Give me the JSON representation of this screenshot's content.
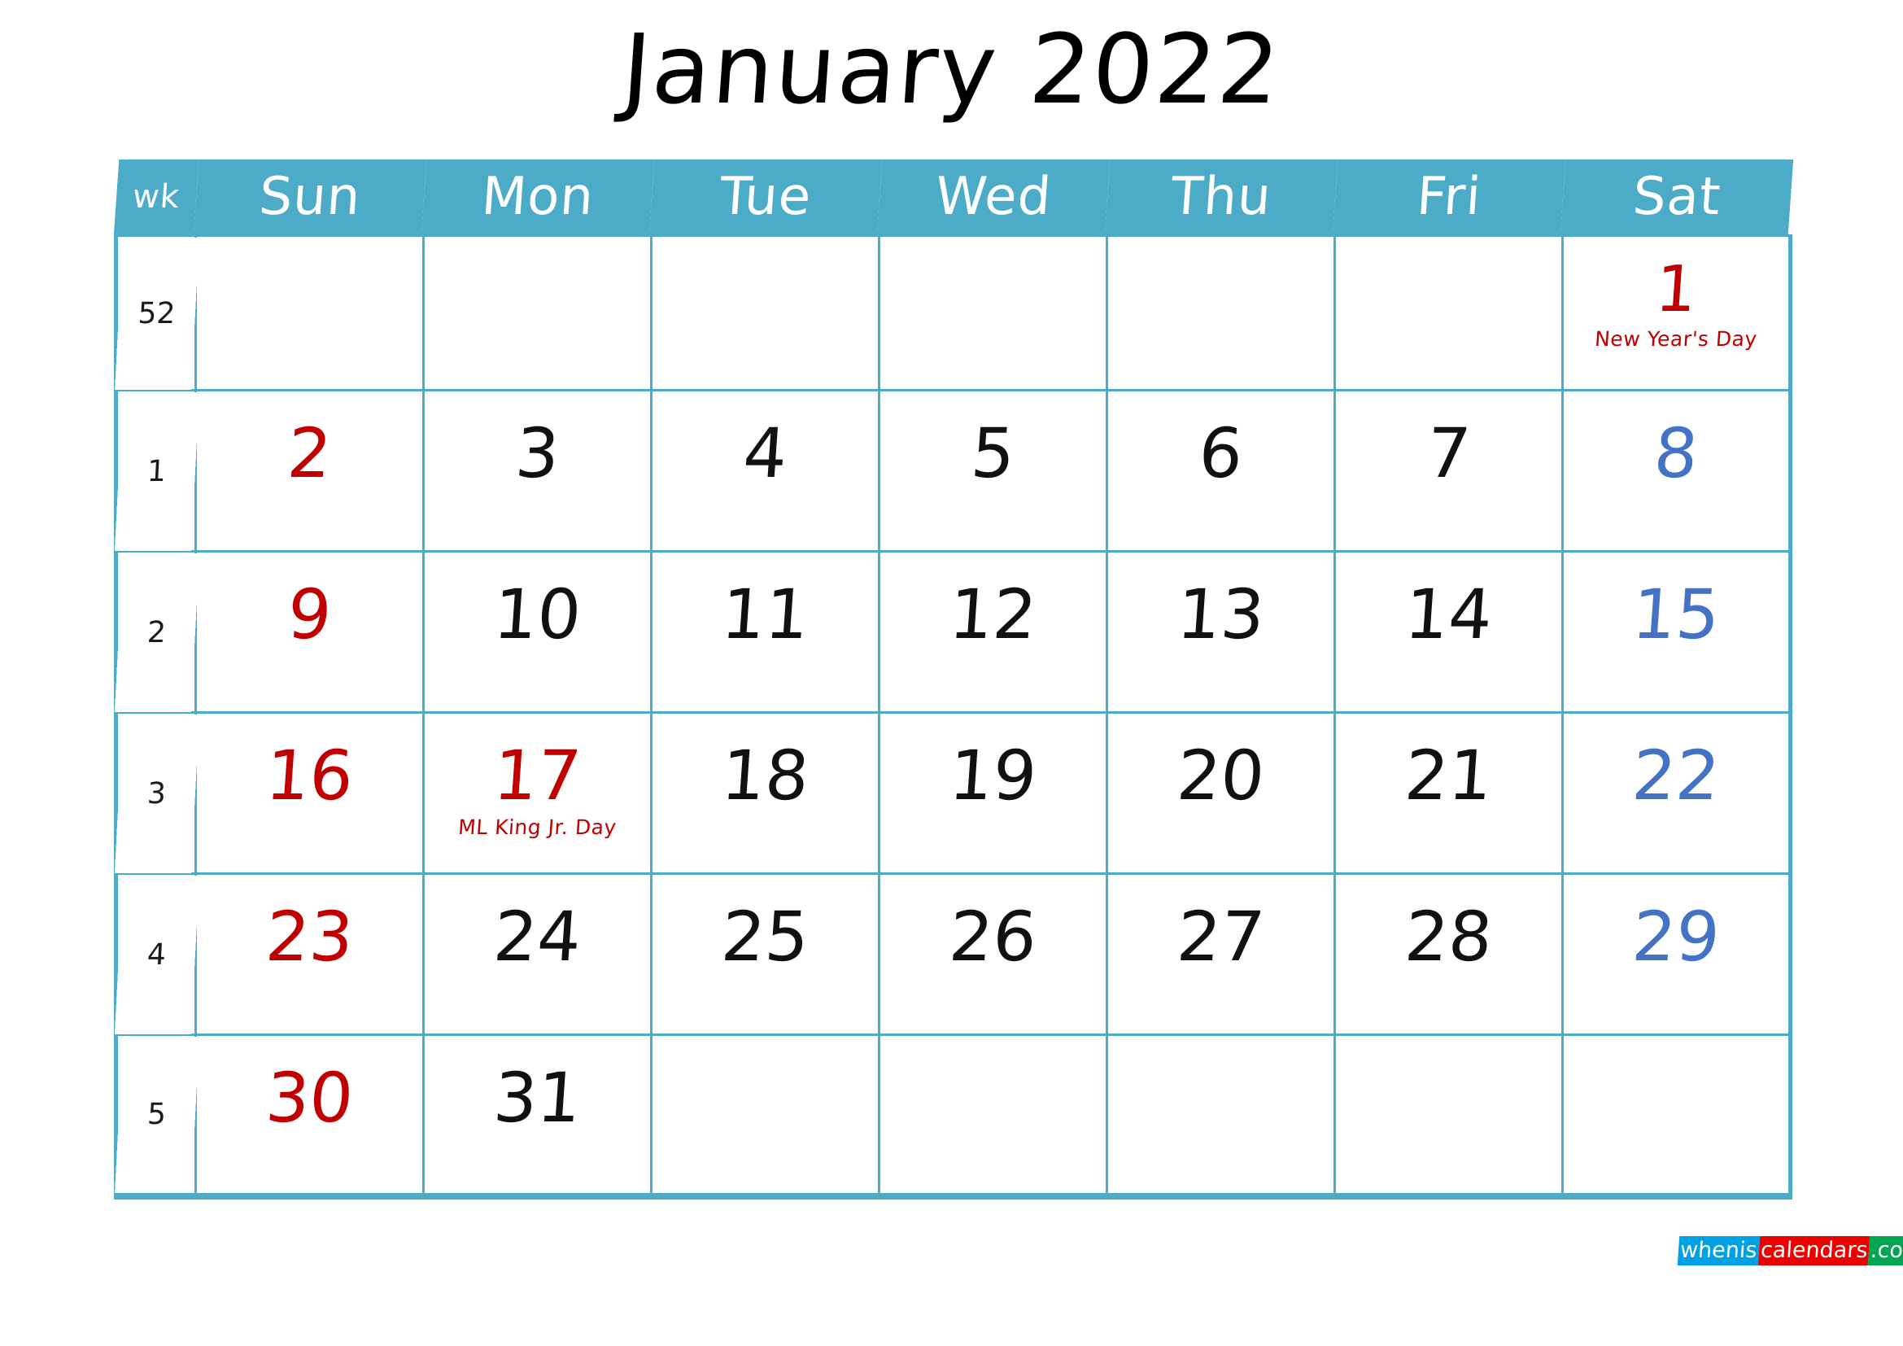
{
  "title": "January 2022",
  "colors": {
    "header_bg": "#4CACC8",
    "grid_line": "#4CACC8",
    "sunday": "#C00000",
    "saturday": "#4472C4",
    "weekday": "#111111",
    "holiday_text": "#C00000"
  },
  "header": {
    "wk": "wk",
    "days": [
      "Sun",
      "Mon",
      "Tue",
      "Wed",
      "Thu",
      "Fri",
      "Sat"
    ]
  },
  "weeks": [
    {
      "wk": "52",
      "days": [
        {
          "num": "",
          "color": "weekday",
          "holiday": ""
        },
        {
          "num": "",
          "color": "weekday",
          "holiday": ""
        },
        {
          "num": "",
          "color": "weekday",
          "holiday": ""
        },
        {
          "num": "",
          "color": "weekday",
          "holiday": ""
        },
        {
          "num": "",
          "color": "weekday",
          "holiday": ""
        },
        {
          "num": "",
          "color": "weekday",
          "holiday": ""
        },
        {
          "num": "1",
          "color": "red",
          "holiday": "New Year's Day"
        }
      ]
    },
    {
      "wk": "1",
      "days": [
        {
          "num": "2",
          "color": "red",
          "holiday": ""
        },
        {
          "num": "3",
          "color": "black",
          "holiday": ""
        },
        {
          "num": "4",
          "color": "black",
          "holiday": ""
        },
        {
          "num": "5",
          "color": "black",
          "holiday": ""
        },
        {
          "num": "6",
          "color": "black",
          "holiday": ""
        },
        {
          "num": "7",
          "color": "black",
          "holiday": ""
        },
        {
          "num": "8",
          "color": "blue",
          "holiday": ""
        }
      ]
    },
    {
      "wk": "2",
      "days": [
        {
          "num": "9",
          "color": "red",
          "holiday": ""
        },
        {
          "num": "10",
          "color": "black",
          "holiday": ""
        },
        {
          "num": "11",
          "color": "black",
          "holiday": ""
        },
        {
          "num": "12",
          "color": "black",
          "holiday": ""
        },
        {
          "num": "13",
          "color": "black",
          "holiday": ""
        },
        {
          "num": "14",
          "color": "black",
          "holiday": ""
        },
        {
          "num": "15",
          "color": "blue",
          "holiday": ""
        }
      ]
    },
    {
      "wk": "3",
      "days": [
        {
          "num": "16",
          "color": "red",
          "holiday": ""
        },
        {
          "num": "17",
          "color": "red",
          "holiday": "ML King Jr. Day"
        },
        {
          "num": "18",
          "color": "black",
          "holiday": ""
        },
        {
          "num": "19",
          "color": "black",
          "holiday": ""
        },
        {
          "num": "20",
          "color": "black",
          "holiday": ""
        },
        {
          "num": "21",
          "color": "black",
          "holiday": ""
        },
        {
          "num": "22",
          "color": "blue",
          "holiday": ""
        }
      ]
    },
    {
      "wk": "4",
      "days": [
        {
          "num": "23",
          "color": "red",
          "holiday": ""
        },
        {
          "num": "24",
          "color": "black",
          "holiday": ""
        },
        {
          "num": "25",
          "color": "black",
          "holiday": ""
        },
        {
          "num": "26",
          "color": "black",
          "holiday": ""
        },
        {
          "num": "27",
          "color": "black",
          "holiday": ""
        },
        {
          "num": "28",
          "color": "black",
          "holiday": ""
        },
        {
          "num": "29",
          "color": "blue",
          "holiday": ""
        }
      ]
    },
    {
      "wk": "5",
      "days": [
        {
          "num": "30",
          "color": "red",
          "holiday": ""
        },
        {
          "num": "31",
          "color": "black",
          "holiday": ""
        },
        {
          "num": "",
          "color": "weekday",
          "holiday": ""
        },
        {
          "num": "",
          "color": "weekday",
          "holiday": ""
        },
        {
          "num": "",
          "color": "weekday",
          "holiday": ""
        },
        {
          "num": "",
          "color": "weekday",
          "holiday": ""
        },
        {
          "num": "",
          "color": "weekday",
          "holiday": ""
        }
      ]
    }
  ],
  "logo": {
    "part1": "whenis",
    "part2": "calendars",
    "part3": ".com"
  }
}
